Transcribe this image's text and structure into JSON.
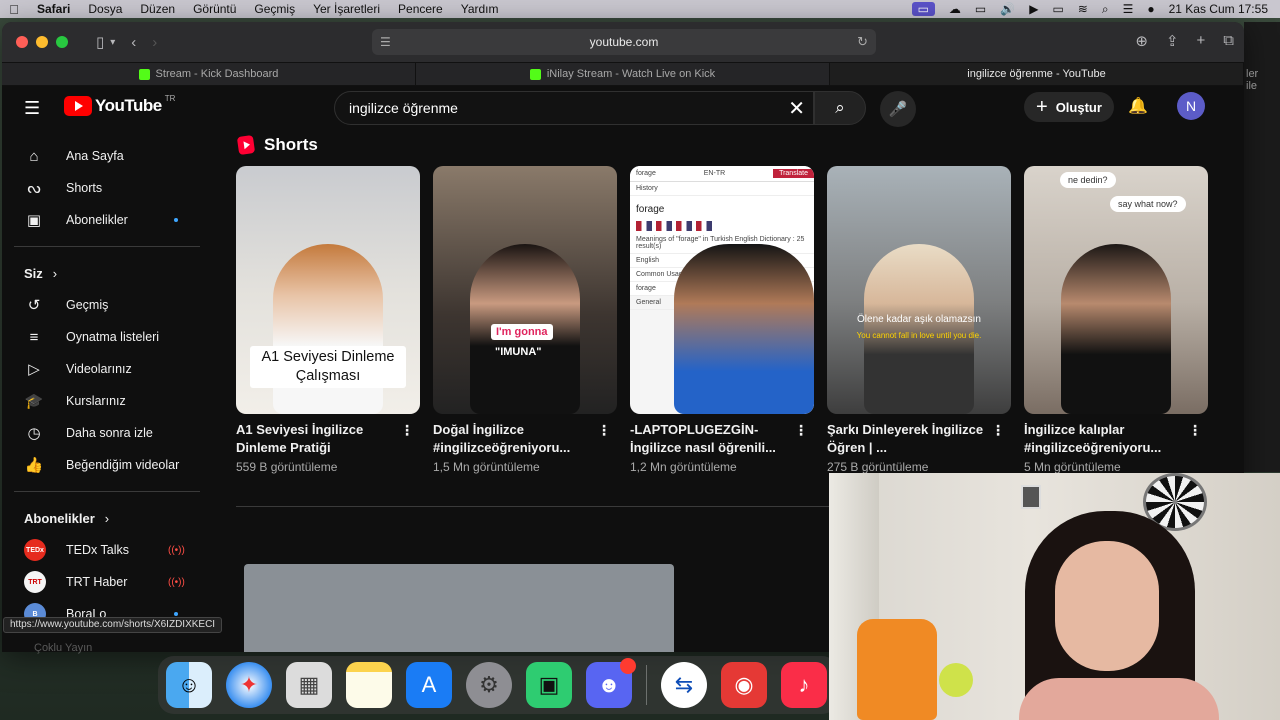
{
  "menubar": {
    "apple": "",
    "app": "Safari",
    "items": [
      "Dosya",
      "Düzen",
      "Görüntü",
      "Geçmiş",
      "Yer İşaretleri",
      "Pencere",
      "Yardım"
    ],
    "clock": "21 Kas Cum  17:55"
  },
  "browser": {
    "url": "youtube.com",
    "tabs": [
      {
        "label": "Stream - Kick Dashboard",
        "favicon": "kick"
      },
      {
        "label": "iNilay Stream - Watch Live on Kick",
        "favicon": "kick"
      },
      {
        "label": "ingilizce öğrenme - YouTube",
        "favicon": "youtube"
      }
    ]
  },
  "youtube": {
    "logo_text": "YouTube",
    "region": "TR",
    "search_value": "ingilizce öğrenme",
    "create_label": "Oluştur",
    "avatar_letter": "N"
  },
  "sidebar": {
    "main": [
      {
        "label": "Ana Sayfa",
        "icon": "home-icon"
      },
      {
        "label": "Shorts",
        "icon": "shorts-icon"
      },
      {
        "label": "Abonelikler",
        "icon": "subscriptions-icon"
      }
    ],
    "you_title": "Siz",
    "you": [
      {
        "label": "Geçmiş",
        "icon": "history-icon"
      },
      {
        "label": "Oynatma listeleri",
        "icon": "playlist-icon"
      },
      {
        "label": "Videolarınız",
        "icon": "video-icon"
      },
      {
        "label": "Kurslarınız",
        "icon": "courses-icon"
      },
      {
        "label": "Daha sonra izle",
        "icon": "clock-icon"
      },
      {
        "label": "Beğendiğim videolar",
        "icon": "thumbs-up-icon"
      }
    ],
    "subs_title": "Abonelikler",
    "subs": [
      {
        "label": "TEDx Talks",
        "avatar": "TEDx"
      },
      {
        "label": "TRT Haber",
        "avatar": "TRT"
      },
      {
        "label": "BoraLo",
        "avatar": "B"
      }
    ],
    "more_label": "Çoklu Yayın"
  },
  "shorts": {
    "title": "Shorts",
    "items": [
      {
        "title": "A1 Seviyesi İngilizce Dinleme Pratiği",
        "views": "559 B görüntüleme",
        "caption": "A1 Seviyesi Dinleme Çalışması"
      },
      {
        "title": "Doğal İngilizce #ingilizceöğreniyoru...",
        "views": "1,5 Mn görüntüleme",
        "caption_top": "I'm gonna",
        "caption_bottom": "\"IMUNA\""
      },
      {
        "title": "-LAPTOPLUGEZGİN- İngilizce nasıl öğrenili...",
        "views": "1,2 Mn görüntüleme",
        "dict_word": "forage",
        "dict_lang": "EN-TR",
        "dict_btn": "Translate",
        "dict_meanings": "Meanings of \"forage\" in Turkish English Dictionary : 25 result(s)",
        "dict_tab": "English",
        "dict_row1": "Common Usage",
        "dict_row2": "forage",
        "dict_row3": "General",
        "dict_history": "History"
      },
      {
        "title": "Şarkı Dinleyerek İngilizce Öğren | ...",
        "views": "275 B görüntüleme",
        "caption_tr": "Ölene kadar aşık olamazsın",
        "caption_en": "You cannot fall in love until you die."
      },
      {
        "title": "İngilizce kalıplar #ingilizceöğreniyoru...",
        "views": "5 Mn görüntüleme",
        "bubble1": "ne dedin?",
        "bubble2": "say what now?"
      }
    ]
  },
  "status_url": "https://www.youtube.com/shorts/X6IZDIXKECI",
  "bg_window_text": "ler\nile"
}
